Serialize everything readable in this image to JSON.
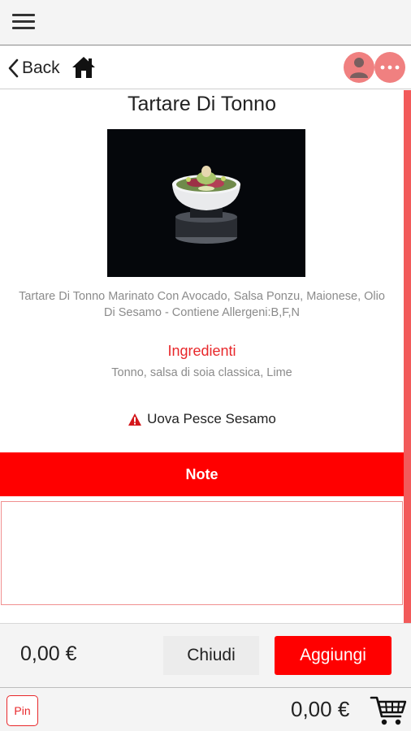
{
  "header": {
    "menu_icon": "hamburger-menu-icon",
    "back_label": "Back",
    "home_icon": "home-icon",
    "user_icon": "user-icon",
    "more_icon": "more-dots-icon"
  },
  "product": {
    "title": "Tartare Di Tonno",
    "description": "Tartare Di Tonno Marinato Con Avocado, Salsa Ponzu, Maionese, Olio Di Sesamo - Contiene Allergeni:B,F,N",
    "ingredients_title": "Ingredienti",
    "ingredients": "Tonno, salsa di soia classica, Lime",
    "allergens_icon": "warning-triangle-icon",
    "allergens": "Uova Pesce Sesamo"
  },
  "note": {
    "label": "Note",
    "value": ""
  },
  "footer": {
    "price": "0,00 €",
    "close_label": "Chiudi",
    "add_label": "Aggiungi",
    "pin_label": "Pin",
    "cart_total": "0,00 €",
    "cart_icon": "shopping-cart-icon"
  },
  "colors": {
    "accent": "#ff0000",
    "accent_text": "#e8282b",
    "circle_button": "#f08080",
    "scrollbar": "#f25a5a"
  }
}
